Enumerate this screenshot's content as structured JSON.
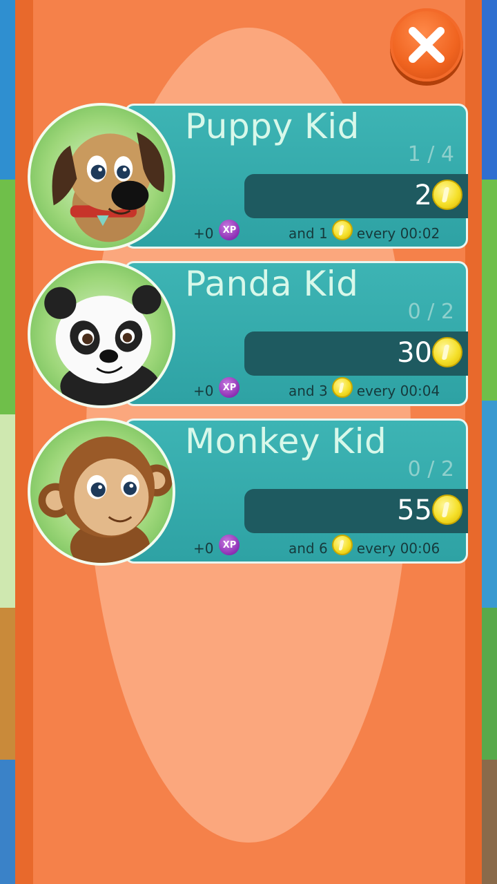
{
  "close_button": {
    "icon": "close-icon"
  },
  "pets": [
    {
      "title": "Puppy Kid",
      "count": "1 / 4",
      "price": "2",
      "xp": "+0",
      "xp_badge": "XP",
      "income_prefix": "and 1",
      "income_suffix": "every 00:02",
      "portrait_icon": "puppy-icon"
    },
    {
      "title": "Panda Kid",
      "count": "0 / 2",
      "price": "30",
      "xp": "+0",
      "xp_badge": "XP",
      "income_prefix": "and 3",
      "income_suffix": "every 00:04",
      "portrait_icon": "panda-icon"
    },
    {
      "title": "Monkey Kid",
      "count": "0 / 2",
      "price": "55",
      "xp": "+0",
      "xp_badge": "XP",
      "income_prefix": "and 6",
      "income_suffix": "every 00:06",
      "portrait_icon": "monkey-icon"
    }
  ],
  "colors": {
    "panel": "#f5814a",
    "card": "#2ea2a4",
    "price_bar": "#1e5a60",
    "coin": "#f5e02a",
    "xp": "#8c2fb4"
  }
}
